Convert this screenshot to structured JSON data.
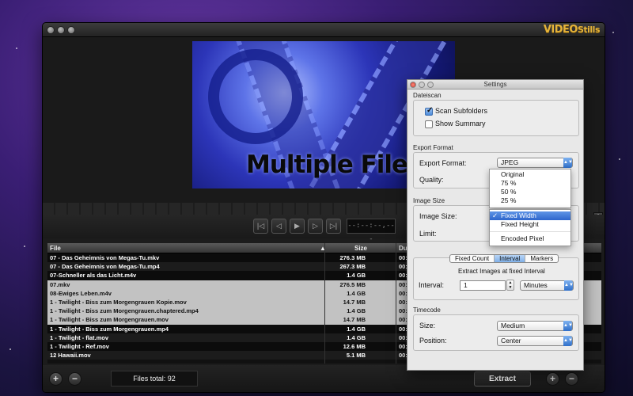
{
  "app": {
    "logo_main": "VIDEO",
    "logo_sub": "Stills",
    "preview_text": "Multiple Files",
    "timecode": "--:--:--,---",
    "files_total": "Files total: 92",
    "extract_label": "Extract",
    "add_label": "+",
    "remove_label": "−",
    "side_plus": "+",
    "side_minus": "−"
  },
  "transport": {
    "icons": [
      "skip-start-icon",
      "step-back-icon",
      "play-icon",
      "step-forward-icon",
      "skip-end-icon"
    ],
    "glyphs": [
      "|◁",
      "◁",
      "▶",
      "▷",
      "▷|"
    ]
  },
  "table": {
    "headers": {
      "file": "File",
      "size": "Size",
      "duration": "Dur"
    },
    "sort_indicator": "▲",
    "rows": [
      {
        "name": "07 - Das Geheimnis von Megas-Tu.mkv",
        "size": "276.3 MB",
        "dur": "00:",
        "selected": false
      },
      {
        "name": "07 - Das Geheimnis von Megas-Tu.mp4",
        "size": "267.3 MB",
        "dur": "00:",
        "selected": false
      },
      {
        "name": "07-Schneller als das Licht.m4v",
        "size": "1.4 GB",
        "dur": "00:",
        "selected": false
      },
      {
        "name": "07.mkv",
        "size": "276.5 MB",
        "dur": "00:",
        "selected": true
      },
      {
        "name": "08-Ewiges Leben.m4v",
        "size": "1.4 GB",
        "dur": "00:",
        "selected": true
      },
      {
        "name": "1 - Twilight - Biss zum Morgengrauen Kopie.mov",
        "size": "14.7 MB",
        "dur": "00:",
        "selected": true
      },
      {
        "name": "1 - Twilight - Biss zum Morgengrauen.chaptered.mp4",
        "size": "1.4 GB",
        "dur": "00:",
        "selected": true
      },
      {
        "name": "1 - Twilight - Biss zum Morgengrauen.mov",
        "size": "14.7 MB",
        "dur": "00:",
        "selected": true
      },
      {
        "name": "1 - Twilight - Biss zum Morgengrauen.mp4",
        "size": "1.4 GB",
        "dur": "00:",
        "selected": false
      },
      {
        "name": "1 - Twilight - flat.mov",
        "size": "1.4 GB",
        "dur": "00:",
        "selected": false
      },
      {
        "name": "1 - Twilight - Ref.mov",
        "size": "12.6 MB",
        "dur": "00:",
        "selected": false
      },
      {
        "name": "12 Hawaii.mov",
        "size": "5.1 MB",
        "dur": "00:",
        "selected": false
      }
    ]
  },
  "settings": {
    "title": "Settings",
    "dateiscan": {
      "title": "Dateiscan",
      "scan_subfolders": "Scan Subfolders",
      "show_summary": "Show Summary"
    },
    "export": {
      "title": "Export Format",
      "format_label": "Export Format:",
      "format_value": "JPEG",
      "quality_label": "Quality:",
      "quality_options": [
        "Original",
        "75 %",
        "50 %",
        "25 %"
      ]
    },
    "image_size": {
      "title": "Image Size",
      "size_label": "Image Size:",
      "limit_label": "Limit:",
      "options": [
        "Fixed Width",
        "Fixed Height",
        "Encoded Pixel"
      ],
      "selected": "Fixed Width",
      "check": "✓"
    },
    "extract": {
      "tabs": [
        "Fixed Count",
        "Interval",
        "Markers"
      ],
      "active_tab": "Interval",
      "caption": "Extract Images at fixed Interval",
      "interval_label": "Interval:",
      "interval_value": "1",
      "unit_value": "Minutes"
    },
    "timecode": {
      "title": "Timecode",
      "size_label": "Size:",
      "size_value": "Medium",
      "position_label": "Position:",
      "position_value": "Center"
    }
  }
}
